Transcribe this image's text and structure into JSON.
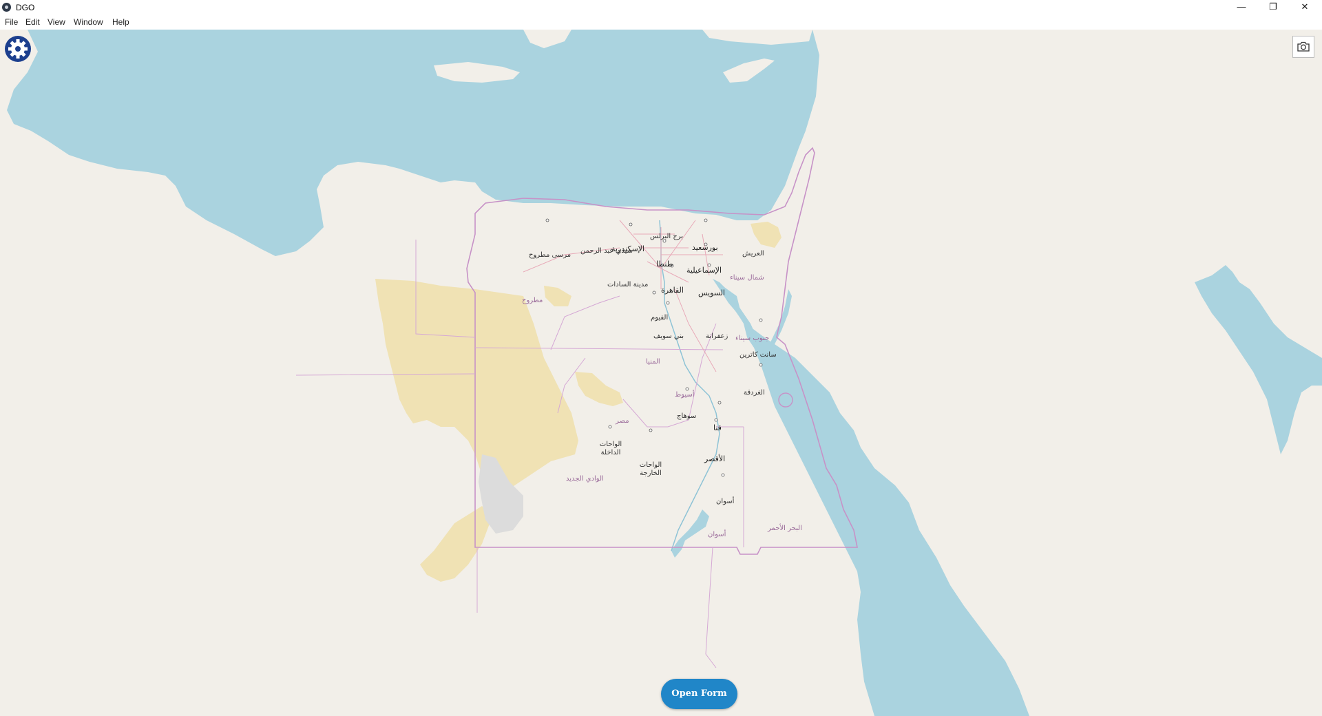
{
  "window": {
    "title": "DGO",
    "minimize_glyph": "—",
    "maximize_glyph": "❐",
    "close_glyph": "✕"
  },
  "menu": [
    "File",
    "Edit",
    "View",
    "Window",
    "Help"
  ],
  "icons": {
    "settings": "gear-icon",
    "screenshot": "camera-icon"
  },
  "colors": {
    "water": "#aad3df",
    "land": "#f2efe9",
    "desert": "#f0e2b4",
    "border": "#c792c7",
    "button": "#2086c8"
  },
  "map": {
    "labels": [
      "بورسعيد",
      "برج البرلس",
      "العريش",
      "الإسكندرية",
      "سيدي عبد الرحمن",
      "مرسى مطروح",
      "طنطا",
      "الإسماعيلية",
      "شمال سيناء",
      "مدينة السادات",
      "القاهرة",
      "السويس",
      "مطروح",
      "الفيوم",
      "بني سويف",
      "زعفرانة",
      "جنوب سيناء",
      "سانت كاترين",
      "المنيا",
      "الغردقة",
      "أسيوط",
      "سوهاج",
      "مصر",
      "قنا",
      "الواحات الداخلة",
      "الأقصر",
      "الواحات الخارجة",
      "الوادي الجديد",
      "أسوان",
      "البحر الأحمر",
      "أسوان"
    ]
  },
  "open_form_label": "Open Form"
}
